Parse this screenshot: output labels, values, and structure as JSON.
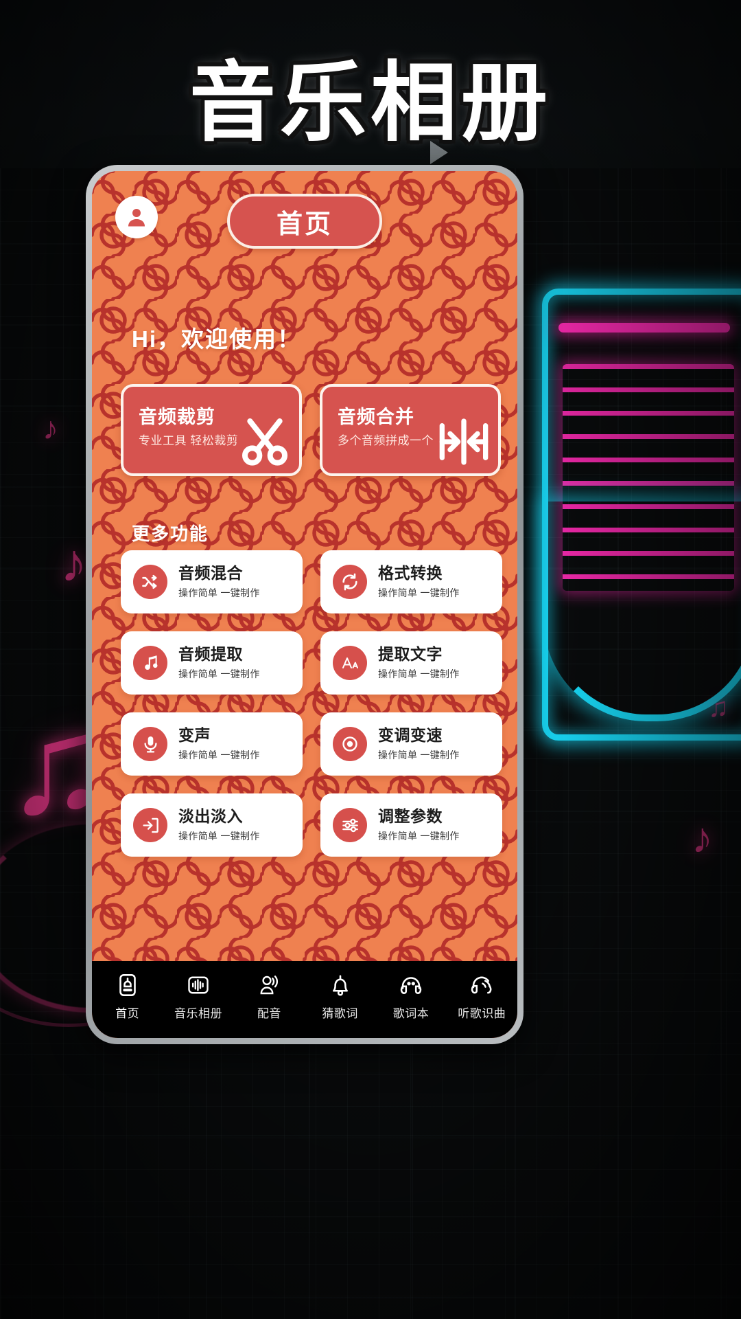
{
  "poster": {
    "title": "音乐相册"
  },
  "app": {
    "header": {
      "avatar_icon": "user-avatar-icon",
      "home_pill_label": "首页"
    },
    "greeting": "Hi，欢迎使用！",
    "feature_cards": [
      {
        "title": "音频裁剪",
        "subtitle": "专业工具 轻松裁剪",
        "icon": "scissors-icon"
      },
      {
        "title": "音频合并",
        "subtitle": "多个音频拼成一个",
        "icon": "merge-arrows-icon"
      }
    ],
    "more_section": {
      "title": "更多功能"
    },
    "tools": [
      {
        "title": "音频混合",
        "subtitle": "操作简单 一键制作",
        "icon": "shuffle-icon"
      },
      {
        "title": "格式转换",
        "subtitle": "操作简单 一键制作",
        "icon": "refresh-sync-icon"
      },
      {
        "title": "音频提取",
        "subtitle": "操作简单 一键制作",
        "icon": "music-note-icon"
      },
      {
        "title": "提取文字",
        "subtitle": "操作简单 一键制作",
        "icon": "font-size-aa-icon"
      },
      {
        "title": "变声",
        "subtitle": "操作简单 一键制作",
        "icon": "microphone-icon"
      },
      {
        "title": "变调变速",
        "subtitle": "操作简单 一键制作",
        "icon": "disc-knob-icon"
      },
      {
        "title": "淡出淡入",
        "subtitle": "操作简单 一键制作",
        "icon": "fade-in-out-icon"
      },
      {
        "title": "调整参数",
        "subtitle": "操作简单 一键制作",
        "icon": "sliders-icon"
      }
    ],
    "bottom_nav": [
      {
        "label": "首页",
        "icon": "home-bell-card-icon",
        "active": true
      },
      {
        "label": "音乐相册",
        "icon": "waveform-square-icon",
        "active": false
      },
      {
        "label": "配音",
        "icon": "dubbing-person-icon",
        "active": false
      },
      {
        "label": "猜歌词",
        "icon": "bell-icon",
        "active": false
      },
      {
        "label": "歌词本",
        "icon": "headphones-icon",
        "active": false
      },
      {
        "label": "听歌识曲",
        "icon": "listen-identify-icon",
        "active": false
      }
    ]
  },
  "colors": {
    "screen_bg": "#ef8150",
    "maze_line": "#b8322c",
    "accent_red": "#d6534f",
    "card_white": "#ffffff",
    "nav_bg": "#000000",
    "neon_cyan": "#19d7f5",
    "neon_pink": "#ff2bb5"
  }
}
